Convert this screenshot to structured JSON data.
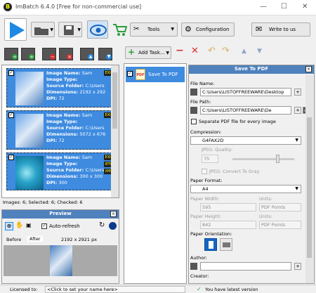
{
  "window": {
    "title": "ImBatch 6.4.0 [Free for non-commercial use]",
    "min": "—",
    "max": "☐",
    "close": "✕"
  },
  "toolbar": {
    "tools_label": "Tools",
    "configuration_label": "Configuration",
    "write_label": "Write to us"
  },
  "tasks": {
    "add_task_label": "Add Task...",
    "task_name": "Save To PDF"
  },
  "images": [
    {
      "name_label": "Image Name:",
      "name_value": "Sam",
      "type_label": "Image Type:",
      "folder_label": "Source Folder:",
      "folder_value": "C:\\Users",
      "dim_label": "Dimensions:",
      "dim_value": "2192 x 292",
      "dpi_label": "DPI:",
      "dpi_value": "72",
      "tag1": "EXIF"
    },
    {
      "name_label": "Image Name:",
      "name_value": "Sam",
      "type_label": "Image Type:",
      "folder_label": "Source Folder:",
      "folder_value": "C:\\Users",
      "dim_label": "Dimensions:",
      "dim_value": "5072 x 676",
      "dpi_label": "DPI:",
      "dpi_value": "72",
      "tag1": "EXIF"
    },
    {
      "name_label": "Image Name:",
      "name_value": "Sam",
      "type_label": "Image Type:",
      "folder_label": "Source Folder:",
      "folder_value": "C:\\Users",
      "dim_label": "Dimensions:",
      "dim_value": "300 x 300",
      "dpi_label": "DPI:",
      "dpi_value": "300",
      "tag1": "EXIF",
      "tag2": "IPTC",
      "tag3": "XMP"
    }
  ],
  "images_status": "Images: 6; Selected: 6; Checked: 6",
  "preview": {
    "title": "Preview",
    "auto_refresh": "Auto-refresh",
    "tab_before": "Before",
    "tab_after": "After",
    "dims": "2192 x 2921 px"
  },
  "settings": {
    "title": "Save To PDF",
    "file_name_label": "File Name:",
    "file_name_value": "C:\\Users\\LISTOFFREEWARE\\Desktop",
    "file_path_label": "File Path:",
    "file_path_value": "C:\\Users\\LISTOFFREEWARE\\De",
    "separate_label": "Separate PDF file for every image",
    "compression_label": "Compression:",
    "compression_value": "G4FAX2D",
    "jpeg_quality_label": "JPEG: Quality:",
    "jpeg_quality_value": "75",
    "jpeg_gray_label": "JPEG: Convert To Gray",
    "paper_format_label": "Paper Format:",
    "paper_format_value": "A4",
    "paper_width_label": "Paper Width:",
    "paper_width_value": "595",
    "units1_label": "Units:",
    "units1_value": "PDF Points",
    "paper_height_label": "Paper Height:",
    "paper_height_value": "842",
    "units2_label": "Units:",
    "units2_value": "PDF Points",
    "orientation_label": "Paper Orientation:",
    "author_label": "Author:",
    "creator_label": "Creator:"
  },
  "status": {
    "licensed_label": "Licensed to:",
    "licensed_value": "<Click to set your name here>",
    "latest": "You have latest version"
  }
}
